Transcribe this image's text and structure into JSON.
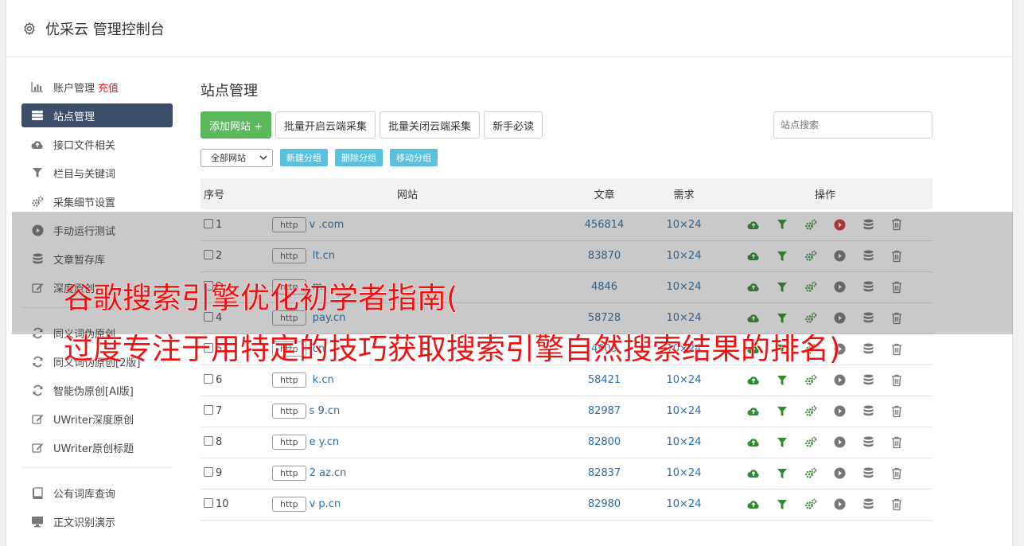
{
  "header": {
    "title": "优采云 管理控制台"
  },
  "sidebar": {
    "items": [
      {
        "icon": "bar-chart-icon",
        "label": "账户管理",
        "extra": "充值",
        "active": false
      },
      {
        "icon": "server-icon",
        "label": "站点管理",
        "extra": "",
        "active": true
      },
      {
        "icon": "cloud-upload-icon",
        "label": "接口文件相关",
        "extra": "",
        "active": false
      },
      {
        "icon": "filter-icon",
        "label": "栏目与关键词",
        "extra": "",
        "active": false
      },
      {
        "icon": "gears-icon",
        "label": "采集细节设置",
        "extra": "",
        "active": false
      },
      {
        "icon": "play-icon",
        "label": "手动运行测试",
        "extra": "",
        "active": false
      },
      {
        "icon": "database-icon",
        "label": "文章暂存库",
        "extra": "",
        "active": false
      },
      {
        "icon": "edit-icon",
        "label": "深度原创",
        "extra": "",
        "active": false
      }
    ],
    "items2": [
      {
        "icon": "refresh-icon",
        "label": "同义词伪原创",
        "active": false
      },
      {
        "icon": "refresh-icon",
        "label": "同义词伪原创[2版]",
        "active": false
      },
      {
        "icon": "refresh-icon",
        "label": "智能伪原创[AI版]",
        "active": false
      },
      {
        "icon": "edit-icon",
        "label": "UWriter深度原创",
        "active": false
      },
      {
        "icon": "edit-icon",
        "label": "UWriter原创标题",
        "active": false
      }
    ],
    "items3": [
      {
        "icon": "book-icon",
        "label": "公有词库查询",
        "active": false
      },
      {
        "icon": "monitor-icon",
        "label": "正文识别演示",
        "active": false
      }
    ]
  },
  "main": {
    "page_title": "站点管理",
    "add_site_label": "添加网站 +",
    "batch_open_label": "批量开启云端采集",
    "batch_close_label": "批量关闭云端采集",
    "guide_label": "新手必读",
    "search_placeholder": "站点搜索",
    "group_select_value": "全部网站",
    "new_group_label": "新建分组",
    "delete_group_label": "删除分组",
    "move_group_label": "移动分组",
    "columns": {
      "num": "序号",
      "site": "网站",
      "articles": "文章",
      "demand": "需求",
      "actions": "操作"
    },
    "rows": [
      {
        "num": "1",
        "protocol": "http",
        "domain": "v          .com",
        "articles": "456814",
        "demand": "10×24",
        "play_active": true
      },
      {
        "num": "2",
        "protocol": "http",
        "domain": "     lt.cn",
        "articles": "83870",
        "demand": "10×24",
        "play_active": false
      },
      {
        "num": "3",
        "protocol": "http",
        "domain": "     m",
        "articles": "4846",
        "demand": "10×24",
        "play_active": false
      },
      {
        "num": "4",
        "protocol": "http",
        "domain": "      pay.cn",
        "articles": "58728",
        "demand": "10×24",
        "play_active": false
      },
      {
        "num": "5",
        "protocol": "http",
        "domain": "      cn",
        "articles": "4909",
        "demand": "10×24",
        "play_active": false
      },
      {
        "num": "6",
        "protocol": "http",
        "domain": "    k.cn",
        "articles": "58421",
        "demand": "10×24",
        "play_active": false
      },
      {
        "num": "7",
        "protocol": "http",
        "domain": "s   9.cn",
        "articles": "82987",
        "demand": "10×24",
        "play_active": false
      },
      {
        "num": "8",
        "protocol": "http",
        "domain": "e     y.cn",
        "articles": "82800",
        "demand": "10×24",
        "play_active": false
      },
      {
        "num": "9",
        "protocol": "http",
        "domain": "2    az.cn",
        "articles": "82837",
        "demand": "10×24",
        "play_active": false
      },
      {
        "num": "10",
        "protocol": "http",
        "domain": "v    p.cn",
        "articles": "82980",
        "demand": "10×24",
        "play_active": false
      }
    ]
  },
  "banner": {
    "line1": "谷歌搜索引擎优化初学者指南(",
    "line2": "过度专注于用特定的技巧获取搜索引擎自然搜索结果的排名)"
  },
  "colors": {
    "accent": "#3d4e6a",
    "green": "#5cb85c",
    "info": "#5bc0de",
    "link": "#2a6ea8",
    "banner_text": "#ee1111"
  }
}
